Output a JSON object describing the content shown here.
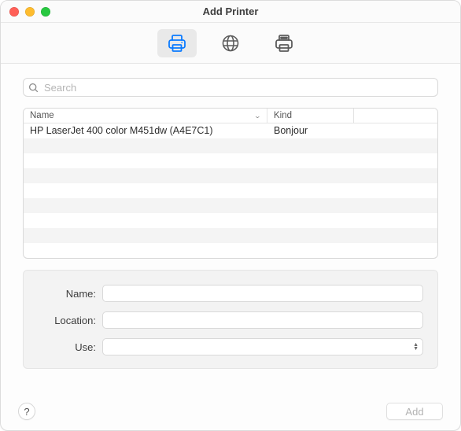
{
  "window": {
    "title": "Add Printer"
  },
  "toolbar": {
    "tabs": [
      {
        "name": "default-printer-icon",
        "selected": true
      },
      {
        "name": "ip-globe-icon",
        "selected": false
      },
      {
        "name": "advanced-printer-icon",
        "selected": false
      }
    ]
  },
  "search": {
    "placeholder": "Search",
    "value": ""
  },
  "list": {
    "columns": {
      "name": "Name",
      "kind": "Kind"
    },
    "rows": [
      {
        "name": "HP LaserJet 400 color M451dw (A4E7C1)",
        "kind": "Bonjour"
      }
    ]
  },
  "form": {
    "name_label": "Name:",
    "name_value": "",
    "location_label": "Location:",
    "location_value": "",
    "use_label": "Use:",
    "use_value": ""
  },
  "footer": {
    "help_label": "?",
    "add_label": "Add"
  }
}
